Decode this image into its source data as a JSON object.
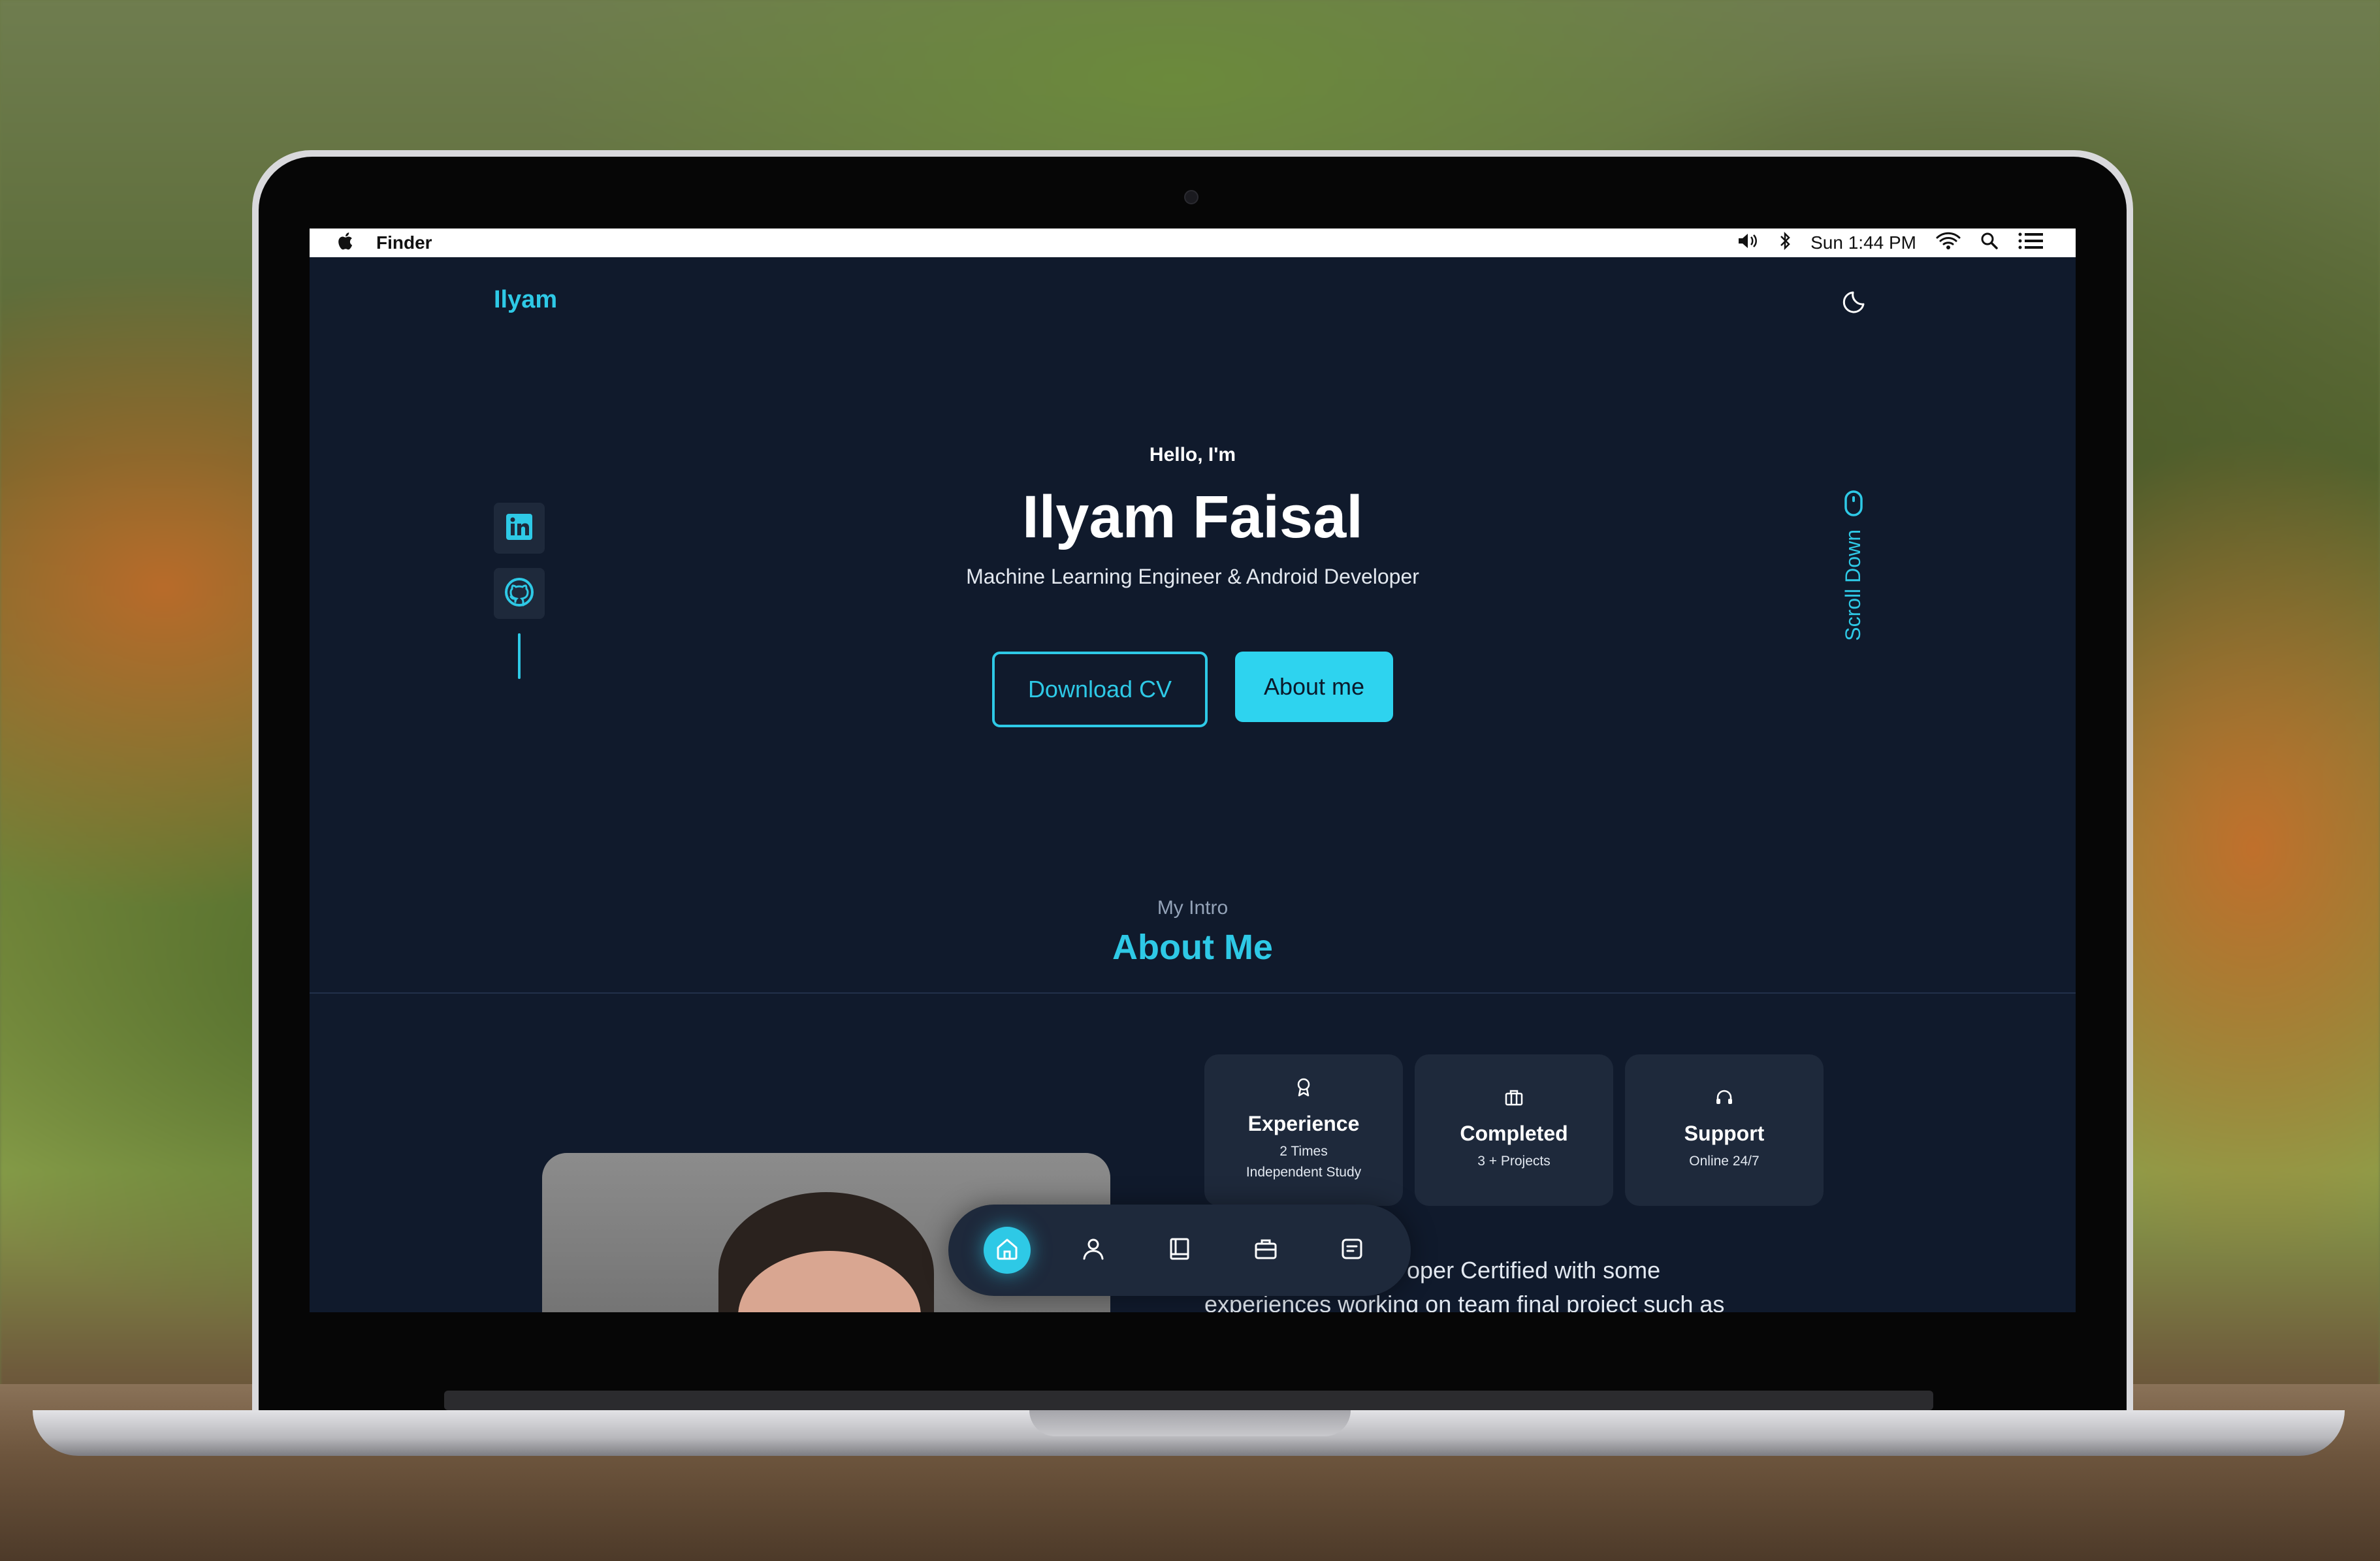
{
  "menubar": {
    "app_name": "Finder",
    "clock": "Sun 1:44 PM"
  },
  "site": {
    "brand": "Ilyam",
    "hero": {
      "greeting": "Hello, I'm",
      "name": "Ilyam Faisal",
      "subtitle": "Machine Learning Engineer & Android Developer",
      "download_cv": "Download CV",
      "about_me_button": "About me"
    },
    "scroll_down": "Scroll Down",
    "intro": {
      "subtitle": "My Intro",
      "title": "About Me"
    },
    "stats": [
      {
        "icon": "award-icon",
        "title": "Experience",
        "sub_1": "2 Times",
        "sub_2": "Independent Study"
      },
      {
        "icon": "briefcase-icon",
        "title": "Completed",
        "sub_1": "3 + Projects",
        "sub_2": ""
      },
      {
        "icon": "headset-icon",
        "title": "Support",
        "sub_1": "Online 24/7",
        "sub_2": ""
      }
    ],
    "about_text_line_1": "oper Certified with some",
    "about_text_line_2": "experiences working on team final project such as"
  },
  "colors": {
    "accent": "#2ec9e6",
    "page_bg": "#101a2c",
    "card_bg": "#1e293b"
  },
  "icons": [
    "apple-icon",
    "volume-icon",
    "bluetooth-icon",
    "wifi-icon",
    "spotlight-search-icon",
    "control-center-icon",
    "moon-icon",
    "linkedin-icon",
    "github-icon",
    "mouse-icon",
    "home-icon",
    "user-icon",
    "book-icon",
    "briefcase-icon",
    "message-icon"
  ]
}
